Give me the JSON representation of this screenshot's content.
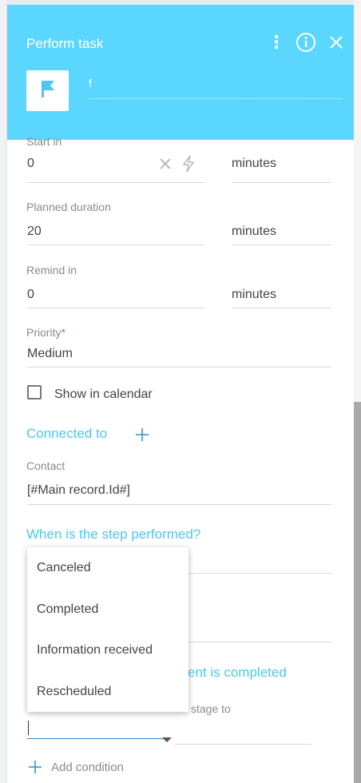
{
  "header": {
    "title": "Perform task",
    "name_value": "f",
    "icons": {
      "more": "kebab-icon",
      "info": "info-icon",
      "close": "close-icon",
      "element": "flag-icon"
    },
    "background_color": "#5bd6ff"
  },
  "form": {
    "start_in": {
      "label": "Start in",
      "value": "0",
      "unit": "minutes"
    },
    "planned_duration": {
      "label": "Planned duration",
      "value": "20",
      "unit": "minutes"
    },
    "remind_in": {
      "label": "Remind in",
      "value": "0",
      "unit": "minutes"
    },
    "priority": {
      "label": "Priority",
      "required_mark": "*",
      "value": "Medium"
    },
    "show_in_calendar": {
      "label": "Show in calendar",
      "checked": false
    },
    "connected_to": {
      "title": "Connected to",
      "add_symbol": "+"
    },
    "contact": {
      "label": "Contact",
      "value": "[#Main record.Id#]"
    },
    "when_performed": {
      "title": "When is the step performed?"
    },
    "completed_section": {
      "title_partial": "ent is completed"
    },
    "stage_label_partial": "stage to",
    "add_condition": {
      "label": "Add condition",
      "symbol": "+"
    }
  },
  "dropdown": {
    "options": [
      "Canceled",
      "Completed",
      "Information received",
      "Rescheduled"
    ]
  },
  "colors": {
    "accent": "#4ec6ef",
    "required": "#e05a4e",
    "focus": "#2f8fd6"
  }
}
